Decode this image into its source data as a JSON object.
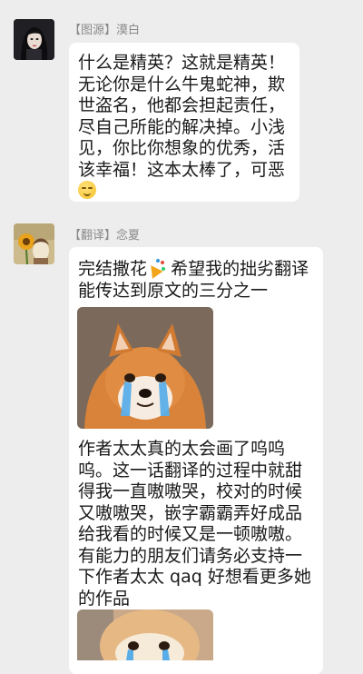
{
  "messages": [
    {
      "sender": "【图源】漠白",
      "text": "什么是精英？这就是精英！无论你是什么牛鬼蛇神，欺世盗名，他都会担起责任，尽自己所能的解决掉。小浅见，你比你想象的优秀，活该幸福！这本太棒了，可恶",
      "emoji": "smiling-face-icon"
    },
    {
      "sender": "【翻译】念夏",
      "text1_a": "完结撒花",
      "text1_b": "希望我的拙劣翻译能传达到原文的三分之一",
      "emoji": "party-popper-icon",
      "image1": "crying-shiba-dog-sticker",
      "text2": "作者太太真的太会画了呜呜呜。这一话翻译的过程中就甜得我一直嗷嗷哭，校对的时候又嗷嗷哭，嵌字霸霸弄好成品给我看的时候又是一顿嗷嗷。有能力的朋友们请务必支持一下作者太太 qaq 好想看更多她的作品",
      "image2": "crying-shiba-dog-sticker-partial"
    }
  ],
  "colors": {
    "background": "#ededed",
    "bubble": "#ffffff",
    "sender_name": "#8a8a8a",
    "text": "#1a1a1a"
  }
}
